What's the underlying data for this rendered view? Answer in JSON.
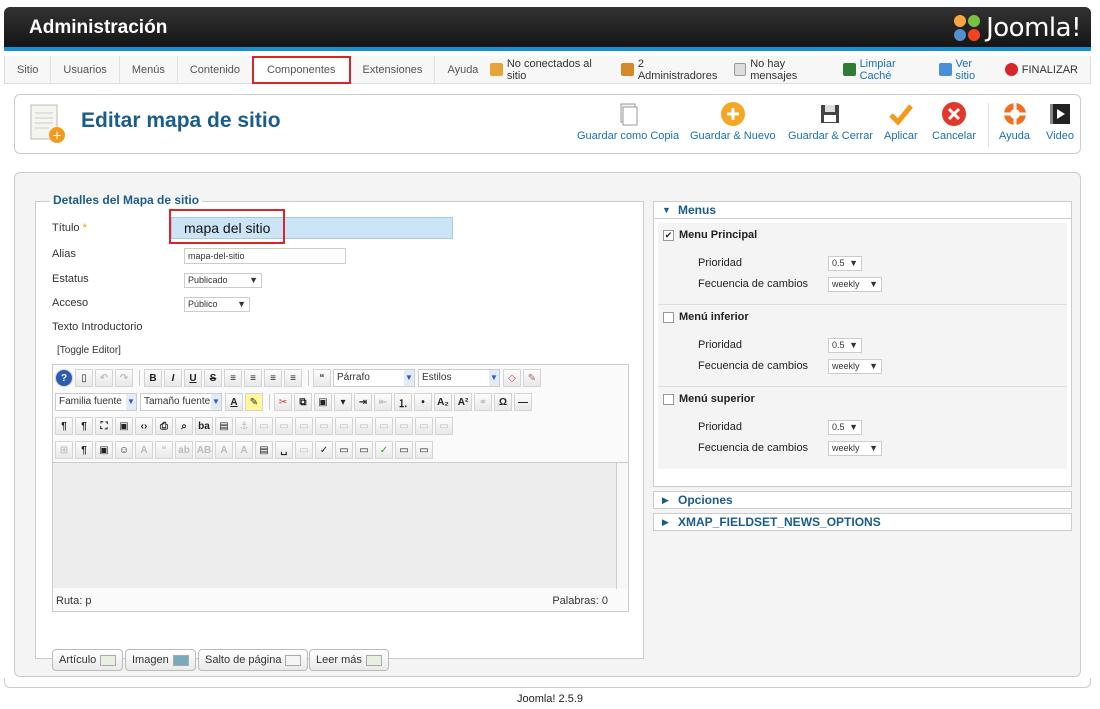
{
  "header": {
    "title": "Administración",
    "brand": "Joomla!"
  },
  "menu": {
    "items": [
      "Sitio",
      "Usuarios",
      "Menús",
      "Contenido",
      "Componentes",
      "Extensiones",
      "Ayuda"
    ],
    "selected": "Componentes"
  },
  "status": {
    "offline": "No conectados al sitio",
    "admins": "2 Administradores",
    "messages": "No hay mensajes",
    "cache": "Limpiar Caché",
    "view_site": "Ver sitio",
    "logout": "FINALIZAR"
  },
  "page": {
    "title": "Editar mapa de sitio"
  },
  "toolbar": {
    "save_copy": "Guardar como Copia",
    "save_new": "Guardar & Nuevo",
    "save_close": "Guardar & Cerrar",
    "apply": "Aplicar",
    "cancel": "Cancelar",
    "help": "Ayuda",
    "video": "Video"
  },
  "form": {
    "legend": "Detalles del Mapa de sitio",
    "title_label": "Título",
    "title_value": "mapa del sitio",
    "alias_label": "Alias",
    "alias_value": "mapa-del-sitio",
    "status_label": "Estatus",
    "status_value": "Publicado",
    "access_label": "Acceso",
    "access_value": "Público",
    "intro_label": "Texto Introductorio",
    "toggle": "[Toggle Editor]"
  },
  "editor": {
    "format": "Párrafo",
    "styles": "Estilos",
    "font_family": "Familia fuente",
    "font_size": "Tamaño fuente",
    "path": "Ruta: p",
    "words": "Palabras: 0"
  },
  "editor_buttons": [
    "Artículo",
    "Imagen",
    "Salto de página",
    "Leer más"
  ],
  "right": {
    "menus_label": "Menus",
    "blocks": [
      {
        "name": "Menu Principal",
        "checked": "✔",
        "priority_label": "Prioridad",
        "priority": "0.5",
        "freq_label": "Fecuencia de cambios",
        "freq": "weekly"
      },
      {
        "name": "Menú inferior",
        "checked": "",
        "priority_label": "Prioridad",
        "priority": "0.5",
        "freq_label": "Fecuencia de cambios",
        "freq": "weekly"
      },
      {
        "name": "Menú superior",
        "checked": "",
        "priority_label": "Prioridad",
        "priority": "0.5",
        "freq_label": "Fecuencia de cambios",
        "freq": "weekly"
      }
    ],
    "options_label": "Opciones",
    "news_label": "XMAP_FIELDSET_NEWS_OPTIONS"
  },
  "footer": {
    "version": "Joomla! 2.5.9"
  }
}
